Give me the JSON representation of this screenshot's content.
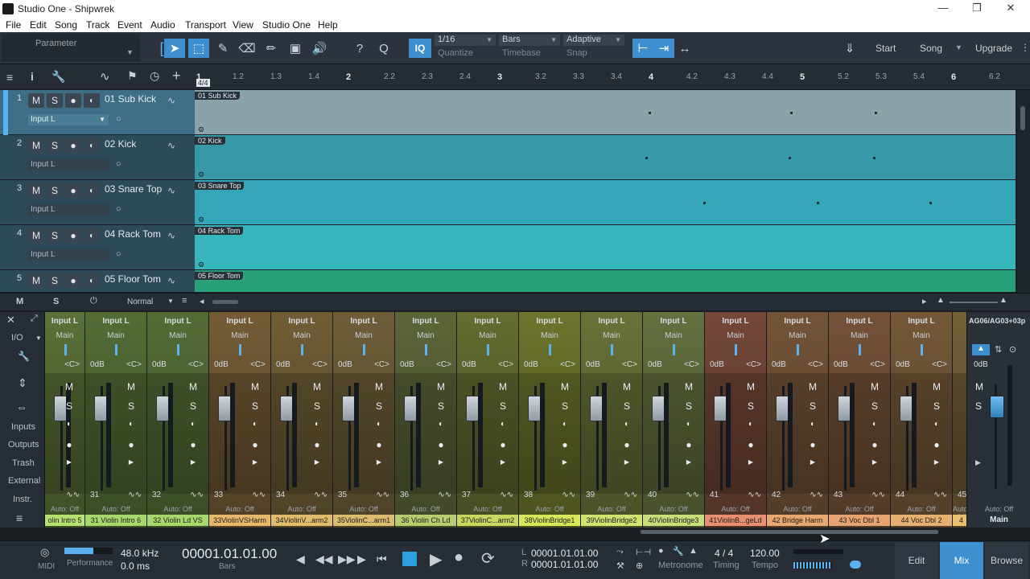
{
  "window": {
    "title": "Studio One - Shipwrek",
    "minimize": "—",
    "restore": "❐",
    "close": "✕"
  },
  "menu": [
    "File",
    "Edit",
    "Song",
    "Track",
    "Event",
    "Audio",
    "Transport",
    "View",
    "Studio One",
    "Help"
  ],
  "toolbar": {
    "parameter_label": "Parameter",
    "quantize": {
      "value": "1/16",
      "label": "Quantize"
    },
    "timebase": {
      "value": "Bars",
      "label": "Timebase"
    },
    "snap": {
      "value": "Adaptive",
      "label": "Snap"
    },
    "iq": "IQ",
    "start": "Start",
    "song": "Song",
    "upgrade": "Upgrade"
  },
  "ruler": {
    "marker": "4/4",
    "ticks": [
      "1",
      "1.2",
      "1.3",
      "1.4",
      "2",
      "2.2",
      "2.3",
      "2.4",
      "3",
      "3.2",
      "3.3",
      "3.4",
      "4",
      "4.2",
      "4.3",
      "4.4",
      "5",
      "5.2",
      "5.3",
      "5.4",
      "6",
      "6.2"
    ]
  },
  "tracks": [
    {
      "num": "1",
      "name": "01 Sub Kick",
      "input": "Input L",
      "clip": "01 Sub Kick"
    },
    {
      "num": "2",
      "name": "02 Kick",
      "input": "Input L",
      "clip": "02 Kick"
    },
    {
      "num": "3",
      "name": "03 Snare Top",
      "input": "Input L",
      "clip": "03 Snare Top"
    },
    {
      "num": "4",
      "name": "04 Rack Tom",
      "input": "Input L",
      "clip": "04 Rack Tom"
    },
    {
      "num": "5",
      "name": "05 Floor Tom",
      "input": "",
      "clip": "05 Floor Tom"
    }
  ],
  "track_buttons": {
    "m": "M",
    "s": "S"
  },
  "arrange_footer": {
    "m": "M",
    "s": "S",
    "mode": "Normal"
  },
  "mixer_left": {
    "io": "I/O",
    "inputs": "Inputs",
    "outputs": "Outputs",
    "trash": "Trash",
    "external": "External",
    "instr": "Instr."
  },
  "strips": [
    {
      "input": "Input L",
      "out": "Main",
      "db": "",
      "num": "",
      "name": "olin Intro 5",
      "color": "#b8e070"
    },
    {
      "input": "Input L",
      "out": "Main",
      "db": "0dB",
      "num": "31",
      "name": "31 Violin Intro 6",
      "color": "#a8d86c"
    },
    {
      "input": "Input L",
      "out": "Main",
      "db": "0dB",
      "num": "32",
      "name": "32 Violin Ld VS",
      "color": "#a8d86c"
    },
    {
      "input": "Input L",
      "out": "Main",
      "db": "0dB",
      "num": "33",
      "name": "33ViolinVSHarm",
      "color": "#e8b86c"
    },
    {
      "input": "Input L",
      "out": "Main",
      "db": "0dB",
      "num": "34",
      "name": "34ViolinV...arm2",
      "color": "#e0bc6c"
    },
    {
      "input": "Input L",
      "out": "Main",
      "db": "0dB",
      "num": "35",
      "name": "35ViolinC...arm1",
      "color": "#dcbc70"
    },
    {
      "input": "Input L",
      "out": "Main",
      "db": "0dB",
      "num": "36",
      "name": "36 Violin Ch Ld",
      "color": "#b8cc70"
    },
    {
      "input": "Input L",
      "out": "Main",
      "db": "0dB",
      "num": "37",
      "name": "37ViolinC...arm2",
      "color": "#c8d860"
    },
    {
      "input": "Input L",
      "out": "Main",
      "db": "0dB",
      "num": "38",
      "name": "38ViolinBridge1",
      "color": "#d8e858"
    },
    {
      "input": "Input L",
      "out": "Main",
      "db": "0dB",
      "num": "39",
      "name": "39ViolinBridge2",
      "color": "#d0e470"
    },
    {
      "input": "Input L",
      "out": "Main",
      "db": "0dB",
      "num": "40",
      "name": "40ViolinBridge3",
      "color": "#c8e07c"
    },
    {
      "input": "Input L",
      "out": "Main",
      "db": "0dB",
      "num": "41",
      "name": "41ViolinB...geLd",
      "color": "#e89070"
    },
    {
      "input": "Input L",
      "out": "Main",
      "db": "0dB",
      "num": "42",
      "name": "42 Bridge Harm",
      "color": "#e8a870"
    },
    {
      "input": "Input L",
      "out": "Main",
      "db": "0dB",
      "num": "43",
      "name": "43 Voc Dbl 1",
      "color": "#e8a470"
    },
    {
      "input": "Input L",
      "out": "Main",
      "db": "0dB",
      "num": "44",
      "name": "44 Voc Dbl 2",
      "color": "#e8b070"
    },
    {
      "input": "",
      "out": "",
      "db": "",
      "num": "45",
      "name": "4",
      "color": "#e8c070"
    }
  ],
  "strip_labels": {
    "cc": "<C>",
    "m": "M",
    "s": "S",
    "auto": "Auto: Off"
  },
  "main_strip": {
    "title": "AG06/AG03+03p",
    "db": "0dB",
    "m": "M",
    "s": "S",
    "auto": "Auto: Off",
    "name": "Main"
  },
  "transport": {
    "midi": "MIDI",
    "performance": "Performance",
    "samplerate": "48.0 kHz",
    "latency": "0.0 ms",
    "position": "00001.01.01.00",
    "position_unit": "Bars",
    "loop_l": "00001.01.01.00",
    "loop_r": "00001.01.01.00",
    "l": "L",
    "r": "R",
    "metronome": "Metronome",
    "timing_value": "4 / 4",
    "timing": "Timing",
    "tempo_value": "120.00",
    "tempo": "Tempo"
  },
  "view_tabs": {
    "edit": "Edit",
    "mix": "Mix",
    "browse": "Browse"
  }
}
